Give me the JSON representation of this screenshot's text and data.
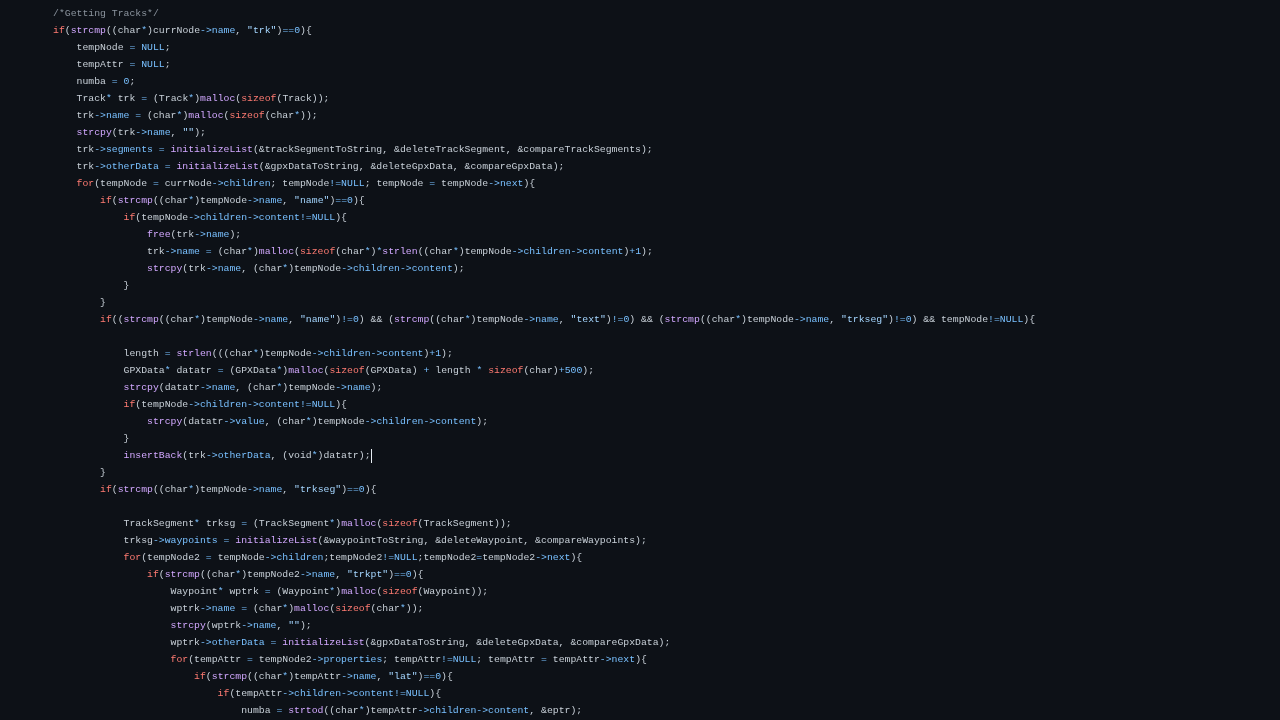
{
  "editor": {
    "lines": [
      {
        "kind": "code",
        "cursor": false,
        "tokens": [
          {
            "kind": "cm",
            "text": "/*Getting Tracks*/"
          }
        ]
      },
      {
        "kind": "code",
        "cursor": false,
        "tokens": [
          {
            "kind": "kw",
            "text": "if"
          },
          {
            "kind": "tx",
            "text": "("
          },
          {
            "kind": "fn",
            "text": "strcmp"
          },
          {
            "kind": "tx",
            "text": "((char"
          },
          {
            "kind": "op",
            "text": "*"
          },
          {
            "kind": "tx",
            "text": ")currNode"
          },
          {
            "kind": "op",
            "text": "->name"
          },
          {
            "kind": "tx",
            "text": ", "
          },
          {
            "kind": "str",
            "text": "\"trk\""
          },
          {
            "kind": "tx",
            "text": ")"
          },
          {
            "kind": "op",
            "text": "==0"
          },
          {
            "kind": "tx",
            "text": "){"
          }
        ]
      },
      {
        "kind": "code",
        "cursor": false,
        "tokens": [
          {
            "kind": "tx",
            "text": "    tempNode "
          },
          {
            "kind": "op",
            "text": "= NULL"
          },
          {
            "kind": "tx",
            "text": ";"
          }
        ]
      },
      {
        "kind": "code",
        "cursor": false,
        "tokens": [
          {
            "kind": "tx",
            "text": "    tempAttr "
          },
          {
            "kind": "op",
            "text": "= NULL"
          },
          {
            "kind": "tx",
            "text": ";"
          }
        ]
      },
      {
        "kind": "code",
        "cursor": false,
        "tokens": [
          {
            "kind": "tx",
            "text": "    numba "
          },
          {
            "kind": "op",
            "text": "= 0"
          },
          {
            "kind": "tx",
            "text": ";"
          }
        ]
      },
      {
        "kind": "code",
        "cursor": false,
        "tokens": [
          {
            "kind": "tx",
            "text": "    Track"
          },
          {
            "kind": "op",
            "text": "*"
          },
          {
            "kind": "tx",
            "text": " trk "
          },
          {
            "kind": "op",
            "text": "="
          },
          {
            "kind": "tx",
            "text": " (Track"
          },
          {
            "kind": "op",
            "text": "*"
          },
          {
            "kind": "tx",
            "text": ")"
          },
          {
            "kind": "fn",
            "text": "malloc"
          },
          {
            "kind": "tx",
            "text": "("
          },
          {
            "kind": "kw",
            "text": "sizeof"
          },
          {
            "kind": "tx",
            "text": "(Track));"
          }
        ]
      },
      {
        "kind": "code",
        "cursor": false,
        "tokens": [
          {
            "kind": "tx",
            "text": "    trk"
          },
          {
            "kind": "op",
            "text": "->name ="
          },
          {
            "kind": "tx",
            "text": " (char"
          },
          {
            "kind": "op",
            "text": "*"
          },
          {
            "kind": "tx",
            "text": ")"
          },
          {
            "kind": "fn",
            "text": "malloc"
          },
          {
            "kind": "tx",
            "text": "("
          },
          {
            "kind": "kw",
            "text": "sizeof"
          },
          {
            "kind": "tx",
            "text": "(char"
          },
          {
            "kind": "op",
            "text": "*"
          },
          {
            "kind": "tx",
            "text": "));"
          }
        ]
      },
      {
        "kind": "code",
        "cursor": false,
        "tokens": [
          {
            "kind": "fn",
            "text": "    strcpy"
          },
          {
            "kind": "tx",
            "text": "(trk"
          },
          {
            "kind": "op",
            "text": "->name"
          },
          {
            "kind": "tx",
            "text": ", "
          },
          {
            "kind": "str",
            "text": "\"\""
          },
          {
            "kind": "tx",
            "text": ");"
          }
        ]
      },
      {
        "kind": "code",
        "cursor": false,
        "tokens": [
          {
            "kind": "tx",
            "text": "    trk"
          },
          {
            "kind": "op",
            "text": "->segments = "
          },
          {
            "kind": "fn",
            "text": "initializeList"
          },
          {
            "kind": "tx",
            "text": "(&trackSegmentToString, &deleteTrackSegment, &compareTrackSegments);"
          }
        ]
      },
      {
        "kind": "code",
        "cursor": false,
        "tokens": [
          {
            "kind": "tx",
            "text": "    trk"
          },
          {
            "kind": "op",
            "text": "->otherData = "
          },
          {
            "kind": "fn",
            "text": "initializeList"
          },
          {
            "kind": "tx",
            "text": "(&gpxDataToString, &deleteGpxData, &compareGpxData);"
          }
        ]
      },
      {
        "kind": "code",
        "cursor": false,
        "tokens": [
          {
            "kind": "kw",
            "text": "    for"
          },
          {
            "kind": "tx",
            "text": "(tempNode "
          },
          {
            "kind": "op",
            "text": "="
          },
          {
            "kind": "tx",
            "text": " currNode"
          },
          {
            "kind": "op",
            "text": "->children"
          },
          {
            "kind": "tx",
            "text": "; tempNode"
          },
          {
            "kind": "op",
            "text": "!=NULL"
          },
          {
            "kind": "tx",
            "text": "; tempNode "
          },
          {
            "kind": "op",
            "text": "="
          },
          {
            "kind": "tx",
            "text": " tempNode"
          },
          {
            "kind": "op",
            "text": "->next"
          },
          {
            "kind": "tx",
            "text": "){"
          }
        ]
      },
      {
        "kind": "code",
        "cursor": false,
        "tokens": [
          {
            "kind": "kw",
            "text": "        if"
          },
          {
            "kind": "tx",
            "text": "("
          },
          {
            "kind": "fn",
            "text": "strcmp"
          },
          {
            "kind": "tx",
            "text": "((char"
          },
          {
            "kind": "op",
            "text": "*"
          },
          {
            "kind": "tx",
            "text": ")tempNode"
          },
          {
            "kind": "op",
            "text": "->name"
          },
          {
            "kind": "tx",
            "text": ", "
          },
          {
            "kind": "str",
            "text": "\"name\""
          },
          {
            "kind": "tx",
            "text": ")"
          },
          {
            "kind": "op",
            "text": "==0"
          },
          {
            "kind": "tx",
            "text": "){"
          }
        ]
      },
      {
        "kind": "code",
        "cursor": false,
        "tokens": [
          {
            "kind": "kw",
            "text": "            if"
          },
          {
            "kind": "tx",
            "text": "(tempNode"
          },
          {
            "kind": "op",
            "text": "->children->content!=NULL"
          },
          {
            "kind": "tx",
            "text": "){"
          }
        ]
      },
      {
        "kind": "code",
        "cursor": false,
        "tokens": [
          {
            "kind": "fn",
            "text": "                free"
          },
          {
            "kind": "tx",
            "text": "(trk"
          },
          {
            "kind": "op",
            "text": "->name"
          },
          {
            "kind": "tx",
            "text": ");"
          }
        ]
      },
      {
        "kind": "code",
        "cursor": false,
        "tokens": [
          {
            "kind": "tx",
            "text": "                trk"
          },
          {
            "kind": "op",
            "text": "->name ="
          },
          {
            "kind": "tx",
            "text": " (char"
          },
          {
            "kind": "op",
            "text": "*"
          },
          {
            "kind": "tx",
            "text": ")"
          },
          {
            "kind": "fn",
            "text": "malloc"
          },
          {
            "kind": "tx",
            "text": "("
          },
          {
            "kind": "kw",
            "text": "sizeof"
          },
          {
            "kind": "tx",
            "text": "(char"
          },
          {
            "kind": "op",
            "text": "*"
          },
          {
            "kind": "tx",
            "text": ")"
          },
          {
            "kind": "op",
            "text": "*"
          },
          {
            "kind": "fn",
            "text": "strlen"
          },
          {
            "kind": "tx",
            "text": "((char"
          },
          {
            "kind": "op",
            "text": "*"
          },
          {
            "kind": "tx",
            "text": ")tempNode"
          },
          {
            "kind": "op",
            "text": "->children->content"
          },
          {
            "kind": "tx",
            "text": ")"
          },
          {
            "kind": "op",
            "text": "+1"
          },
          {
            "kind": "tx",
            "text": ");"
          }
        ]
      },
      {
        "kind": "code",
        "cursor": false,
        "tokens": [
          {
            "kind": "fn",
            "text": "                strcpy"
          },
          {
            "kind": "tx",
            "text": "(trk"
          },
          {
            "kind": "op",
            "text": "->name"
          },
          {
            "kind": "tx",
            "text": ", (char"
          },
          {
            "kind": "op",
            "text": "*"
          },
          {
            "kind": "tx",
            "text": ")tempNode"
          },
          {
            "kind": "op",
            "text": "->children->content"
          },
          {
            "kind": "tx",
            "text": ");"
          }
        ]
      },
      {
        "kind": "code",
        "cursor": false,
        "tokens": [
          {
            "kind": "tx",
            "text": "            }"
          }
        ]
      },
      {
        "kind": "code",
        "cursor": false,
        "tokens": [
          {
            "kind": "tx",
            "text": "        }"
          }
        ]
      },
      {
        "kind": "code",
        "cursor": false,
        "tokens": [
          {
            "kind": "kw",
            "text": "        if"
          },
          {
            "kind": "tx",
            "text": "(("
          },
          {
            "kind": "fn",
            "text": "strcmp"
          },
          {
            "kind": "tx",
            "text": "((char"
          },
          {
            "kind": "op",
            "text": "*"
          },
          {
            "kind": "tx",
            "text": ")tempNode"
          },
          {
            "kind": "op",
            "text": "->name"
          },
          {
            "kind": "tx",
            "text": ", "
          },
          {
            "kind": "str",
            "text": "\"name\""
          },
          {
            "kind": "tx",
            "text": ")"
          },
          {
            "kind": "op",
            "text": "!=0"
          },
          {
            "kind": "tx",
            "text": ") && ("
          },
          {
            "kind": "fn",
            "text": "strcmp"
          },
          {
            "kind": "tx",
            "text": "((char"
          },
          {
            "kind": "op",
            "text": "*"
          },
          {
            "kind": "tx",
            "text": ")tempNode"
          },
          {
            "kind": "op",
            "text": "->name"
          },
          {
            "kind": "tx",
            "text": ", "
          },
          {
            "kind": "str",
            "text": "\"text\""
          },
          {
            "kind": "tx",
            "text": ")"
          },
          {
            "kind": "op",
            "text": "!=0"
          },
          {
            "kind": "tx",
            "text": ") && ("
          },
          {
            "kind": "fn",
            "text": "strcmp"
          },
          {
            "kind": "tx",
            "text": "((char"
          },
          {
            "kind": "op",
            "text": "*"
          },
          {
            "kind": "tx",
            "text": ")tempNode"
          },
          {
            "kind": "op",
            "text": "->name"
          },
          {
            "kind": "tx",
            "text": ", "
          },
          {
            "kind": "str",
            "text": "\"trkseg\""
          },
          {
            "kind": "tx",
            "text": ")"
          },
          {
            "kind": "op",
            "text": "!=0"
          },
          {
            "kind": "tx",
            "text": ") && tempNode"
          },
          {
            "kind": "op",
            "text": "!=NULL"
          },
          {
            "kind": "tx",
            "text": "){"
          }
        ]
      },
      {
        "kind": "blank",
        "cursor": false
      },
      {
        "kind": "code",
        "cursor": false,
        "tokens": [
          {
            "kind": "tx",
            "text": "            length "
          },
          {
            "kind": "op",
            "text": "= "
          },
          {
            "kind": "fn",
            "text": "strlen"
          },
          {
            "kind": "tx",
            "text": "(((char"
          },
          {
            "kind": "op",
            "text": "*"
          },
          {
            "kind": "tx",
            "text": ")tempNode"
          },
          {
            "kind": "op",
            "text": "->children->content"
          },
          {
            "kind": "tx",
            "text": ")"
          },
          {
            "kind": "op",
            "text": "+1"
          },
          {
            "kind": "tx",
            "text": ");"
          }
        ]
      },
      {
        "kind": "code",
        "cursor": false,
        "tokens": [
          {
            "kind": "tx",
            "text": "            GPXData"
          },
          {
            "kind": "op",
            "text": "*"
          },
          {
            "kind": "tx",
            "text": " datatr "
          },
          {
            "kind": "op",
            "text": "="
          },
          {
            "kind": "tx",
            "text": " (GPXData"
          },
          {
            "kind": "op",
            "text": "*"
          },
          {
            "kind": "tx",
            "text": ")"
          },
          {
            "kind": "fn",
            "text": "malloc"
          },
          {
            "kind": "tx",
            "text": "("
          },
          {
            "kind": "kw",
            "text": "sizeof"
          },
          {
            "kind": "tx",
            "text": "(GPXData) "
          },
          {
            "kind": "op",
            "text": "+"
          },
          {
            "kind": "tx",
            "text": " length "
          },
          {
            "kind": "op",
            "text": "* "
          },
          {
            "kind": "kw",
            "text": "sizeof"
          },
          {
            "kind": "tx",
            "text": "(char)"
          },
          {
            "kind": "op",
            "text": "+500"
          },
          {
            "kind": "tx",
            "text": ");"
          }
        ]
      },
      {
        "kind": "code",
        "cursor": false,
        "tokens": [
          {
            "kind": "fn",
            "text": "            strcpy"
          },
          {
            "kind": "tx",
            "text": "(datatr"
          },
          {
            "kind": "op",
            "text": "->name"
          },
          {
            "kind": "tx",
            "text": ", (char"
          },
          {
            "kind": "op",
            "text": "*"
          },
          {
            "kind": "tx",
            "text": ")tempNode"
          },
          {
            "kind": "op",
            "text": "->name"
          },
          {
            "kind": "tx",
            "text": ");"
          }
        ]
      },
      {
        "kind": "code",
        "cursor": false,
        "tokens": [
          {
            "kind": "kw",
            "text": "            if"
          },
          {
            "kind": "tx",
            "text": "(tempNode"
          },
          {
            "kind": "op",
            "text": "->children->content!=NULL"
          },
          {
            "kind": "tx",
            "text": "){"
          }
        ]
      },
      {
        "kind": "code",
        "cursor": false,
        "tokens": [
          {
            "kind": "fn",
            "text": "                strcpy"
          },
          {
            "kind": "tx",
            "text": "(datatr"
          },
          {
            "kind": "op",
            "text": "->value"
          },
          {
            "kind": "tx",
            "text": ", (char"
          },
          {
            "kind": "op",
            "text": "*"
          },
          {
            "kind": "tx",
            "text": ")tempNode"
          },
          {
            "kind": "op",
            "text": "->children->content"
          },
          {
            "kind": "tx",
            "text": ");"
          }
        ]
      },
      {
        "kind": "code",
        "cursor": false,
        "tokens": [
          {
            "kind": "tx",
            "text": "            }"
          }
        ]
      },
      {
        "kind": "code",
        "cursor": true,
        "tokens": [
          {
            "kind": "fn",
            "text": "            insertBack"
          },
          {
            "kind": "tx",
            "text": "(trk"
          },
          {
            "kind": "op",
            "text": "->otherData"
          },
          {
            "kind": "tx",
            "text": ", (void"
          },
          {
            "kind": "op",
            "text": "*"
          },
          {
            "kind": "tx",
            "text": ")datatr);"
          }
        ]
      },
      {
        "kind": "code",
        "cursor": false,
        "tokens": [
          {
            "kind": "tx",
            "text": "        }"
          }
        ]
      },
      {
        "kind": "code",
        "cursor": false,
        "tokens": [
          {
            "kind": "kw",
            "text": "        if"
          },
          {
            "kind": "tx",
            "text": "("
          },
          {
            "kind": "fn",
            "text": "strcmp"
          },
          {
            "kind": "tx",
            "text": "((char"
          },
          {
            "kind": "op",
            "text": "*"
          },
          {
            "kind": "tx",
            "text": ")tempNode"
          },
          {
            "kind": "op",
            "text": "->name"
          },
          {
            "kind": "tx",
            "text": ", "
          },
          {
            "kind": "str",
            "text": "\"trkseg\""
          },
          {
            "kind": "tx",
            "text": ")"
          },
          {
            "kind": "op",
            "text": "==0"
          },
          {
            "kind": "tx",
            "text": "){"
          }
        ]
      },
      {
        "kind": "blank",
        "cursor": false
      },
      {
        "kind": "code",
        "cursor": false,
        "tokens": [
          {
            "kind": "tx",
            "text": "            TrackSegment"
          },
          {
            "kind": "op",
            "text": "*"
          },
          {
            "kind": "tx",
            "text": " trksg "
          },
          {
            "kind": "op",
            "text": "="
          },
          {
            "kind": "tx",
            "text": " (TrackSegment"
          },
          {
            "kind": "op",
            "text": "*"
          },
          {
            "kind": "tx",
            "text": ")"
          },
          {
            "kind": "fn",
            "text": "malloc"
          },
          {
            "kind": "tx",
            "text": "("
          },
          {
            "kind": "kw",
            "text": "sizeof"
          },
          {
            "kind": "tx",
            "text": "(TrackSegment));"
          }
        ]
      },
      {
        "kind": "code",
        "cursor": false,
        "tokens": [
          {
            "kind": "tx",
            "text": "            trksg"
          },
          {
            "kind": "op",
            "text": "->waypoints = "
          },
          {
            "kind": "fn",
            "text": "initializeList"
          },
          {
            "kind": "tx",
            "text": "(&waypointToString, &deleteWaypoint, &compareWaypoints);"
          }
        ]
      },
      {
        "kind": "code",
        "cursor": false,
        "tokens": [
          {
            "kind": "kw",
            "text": "            for"
          },
          {
            "kind": "tx",
            "text": "(tempNode2 "
          },
          {
            "kind": "op",
            "text": "="
          },
          {
            "kind": "tx",
            "text": " tempNode"
          },
          {
            "kind": "op",
            "text": "->children"
          },
          {
            "kind": "tx",
            "text": ";tempNode2"
          },
          {
            "kind": "op",
            "text": "!=NULL"
          },
          {
            "kind": "tx",
            "text": ";tempNode2"
          },
          {
            "kind": "op",
            "text": "="
          },
          {
            "kind": "tx",
            "text": "tempNode2"
          },
          {
            "kind": "op",
            "text": "->next"
          },
          {
            "kind": "tx",
            "text": "){"
          }
        ]
      },
      {
        "kind": "code",
        "cursor": false,
        "tokens": [
          {
            "kind": "kw",
            "text": "                if"
          },
          {
            "kind": "tx",
            "text": "("
          },
          {
            "kind": "fn",
            "text": "strcmp"
          },
          {
            "kind": "tx",
            "text": "((char"
          },
          {
            "kind": "op",
            "text": "*"
          },
          {
            "kind": "tx",
            "text": ")tempNode2"
          },
          {
            "kind": "op",
            "text": "->name"
          },
          {
            "kind": "tx",
            "text": ", "
          },
          {
            "kind": "str",
            "text": "\"trkpt\""
          },
          {
            "kind": "tx",
            "text": ")"
          },
          {
            "kind": "op",
            "text": "==0"
          },
          {
            "kind": "tx",
            "text": "){"
          }
        ]
      },
      {
        "kind": "code",
        "cursor": false,
        "tokens": [
          {
            "kind": "tx",
            "text": "                    Waypoint"
          },
          {
            "kind": "op",
            "text": "*"
          },
          {
            "kind": "tx",
            "text": " wptrk "
          },
          {
            "kind": "op",
            "text": "="
          },
          {
            "kind": "tx",
            "text": " (Waypoint"
          },
          {
            "kind": "op",
            "text": "*"
          },
          {
            "kind": "tx",
            "text": ")"
          },
          {
            "kind": "fn",
            "text": "malloc"
          },
          {
            "kind": "tx",
            "text": "("
          },
          {
            "kind": "kw",
            "text": "sizeof"
          },
          {
            "kind": "tx",
            "text": "(Waypoint));"
          }
        ]
      },
      {
        "kind": "code",
        "cursor": false,
        "tokens": [
          {
            "kind": "tx",
            "text": "                    wptrk"
          },
          {
            "kind": "op",
            "text": "->name ="
          },
          {
            "kind": "tx",
            "text": " (char"
          },
          {
            "kind": "op",
            "text": "*"
          },
          {
            "kind": "tx",
            "text": ")"
          },
          {
            "kind": "fn",
            "text": "malloc"
          },
          {
            "kind": "tx",
            "text": "("
          },
          {
            "kind": "kw",
            "text": "sizeof"
          },
          {
            "kind": "tx",
            "text": "(char"
          },
          {
            "kind": "op",
            "text": "*"
          },
          {
            "kind": "tx",
            "text": "));"
          }
        ]
      },
      {
        "kind": "code",
        "cursor": false,
        "tokens": [
          {
            "kind": "fn",
            "text": "                    strcpy"
          },
          {
            "kind": "tx",
            "text": "(wptrk"
          },
          {
            "kind": "op",
            "text": "->name"
          },
          {
            "kind": "tx",
            "text": ", "
          },
          {
            "kind": "str",
            "text": "\"\""
          },
          {
            "kind": "tx",
            "text": ");"
          }
        ]
      },
      {
        "kind": "code",
        "cursor": false,
        "tokens": [
          {
            "kind": "tx",
            "text": "                    wptrk"
          },
          {
            "kind": "op",
            "text": "->otherData = "
          },
          {
            "kind": "fn",
            "text": "initializeList"
          },
          {
            "kind": "tx",
            "text": "(&gpxDataToString, &deleteGpxData, &compareGpxData);"
          }
        ]
      },
      {
        "kind": "code",
        "cursor": false,
        "tokens": [
          {
            "kind": "kw",
            "text": "                    for"
          },
          {
            "kind": "tx",
            "text": "(tempAttr "
          },
          {
            "kind": "op",
            "text": "="
          },
          {
            "kind": "tx",
            "text": " tempNode2"
          },
          {
            "kind": "op",
            "text": "->properties"
          },
          {
            "kind": "tx",
            "text": "; tempAttr"
          },
          {
            "kind": "op",
            "text": "!=NULL"
          },
          {
            "kind": "tx",
            "text": "; tempAttr "
          },
          {
            "kind": "op",
            "text": "="
          },
          {
            "kind": "tx",
            "text": " tempAttr"
          },
          {
            "kind": "op",
            "text": "->next"
          },
          {
            "kind": "tx",
            "text": "){"
          }
        ]
      },
      {
        "kind": "code",
        "cursor": false,
        "tokens": [
          {
            "kind": "kw",
            "text": "                        if"
          },
          {
            "kind": "tx",
            "text": "("
          },
          {
            "kind": "fn",
            "text": "strcmp"
          },
          {
            "kind": "tx",
            "text": "((char"
          },
          {
            "kind": "op",
            "text": "*"
          },
          {
            "kind": "tx",
            "text": ")tempAttr"
          },
          {
            "kind": "op",
            "text": "->name"
          },
          {
            "kind": "tx",
            "text": ", "
          },
          {
            "kind": "str",
            "text": "\"lat\""
          },
          {
            "kind": "tx",
            "text": ")"
          },
          {
            "kind": "op",
            "text": "==0"
          },
          {
            "kind": "tx",
            "text": "){"
          }
        ]
      },
      {
        "kind": "code",
        "cursor": false,
        "tokens": [
          {
            "kind": "kw",
            "text": "                            if"
          },
          {
            "kind": "tx",
            "text": "(tempAttr"
          },
          {
            "kind": "op",
            "text": "->children->content!=NULL"
          },
          {
            "kind": "tx",
            "text": "){"
          }
        ]
      },
      {
        "kind": "code",
        "cursor": false,
        "tokens": [
          {
            "kind": "tx",
            "text": "                                numba "
          },
          {
            "kind": "op",
            "text": "= "
          },
          {
            "kind": "fn",
            "text": "strtod"
          },
          {
            "kind": "tx",
            "text": "((char"
          },
          {
            "kind": "op",
            "text": "*"
          },
          {
            "kind": "tx",
            "text": ")tempAttr"
          },
          {
            "kind": "op",
            "text": "->children->content"
          },
          {
            "kind": "tx",
            "text": ", &eptr);"
          }
        ]
      }
    ]
  }
}
